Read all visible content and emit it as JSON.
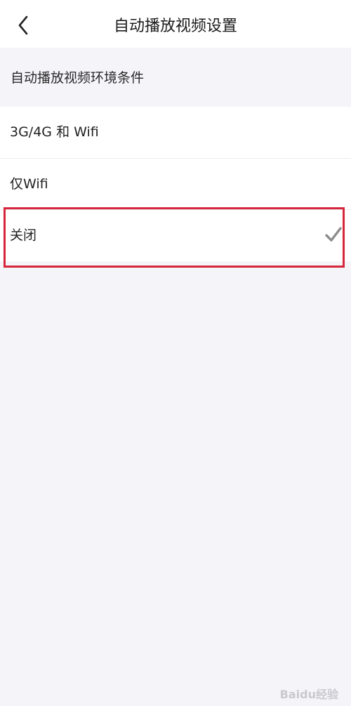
{
  "nav": {
    "title": "自动播放视频设置"
  },
  "section": {
    "header": "自动播放视频环境条件"
  },
  "options": [
    {
      "label": "3G/4G 和 Wifi",
      "selected": false
    },
    {
      "label": "仅Wifi",
      "selected": false
    },
    {
      "label": "关闭",
      "selected": true
    }
  ],
  "icons": {
    "back": "chevron-left-icon",
    "check": "check-icon"
  },
  "colors": {
    "highlight_border": "#d6263b",
    "check_color": "#8c8c8c",
    "background": "#f4f4f9"
  },
  "watermark": "Baidu经验"
}
